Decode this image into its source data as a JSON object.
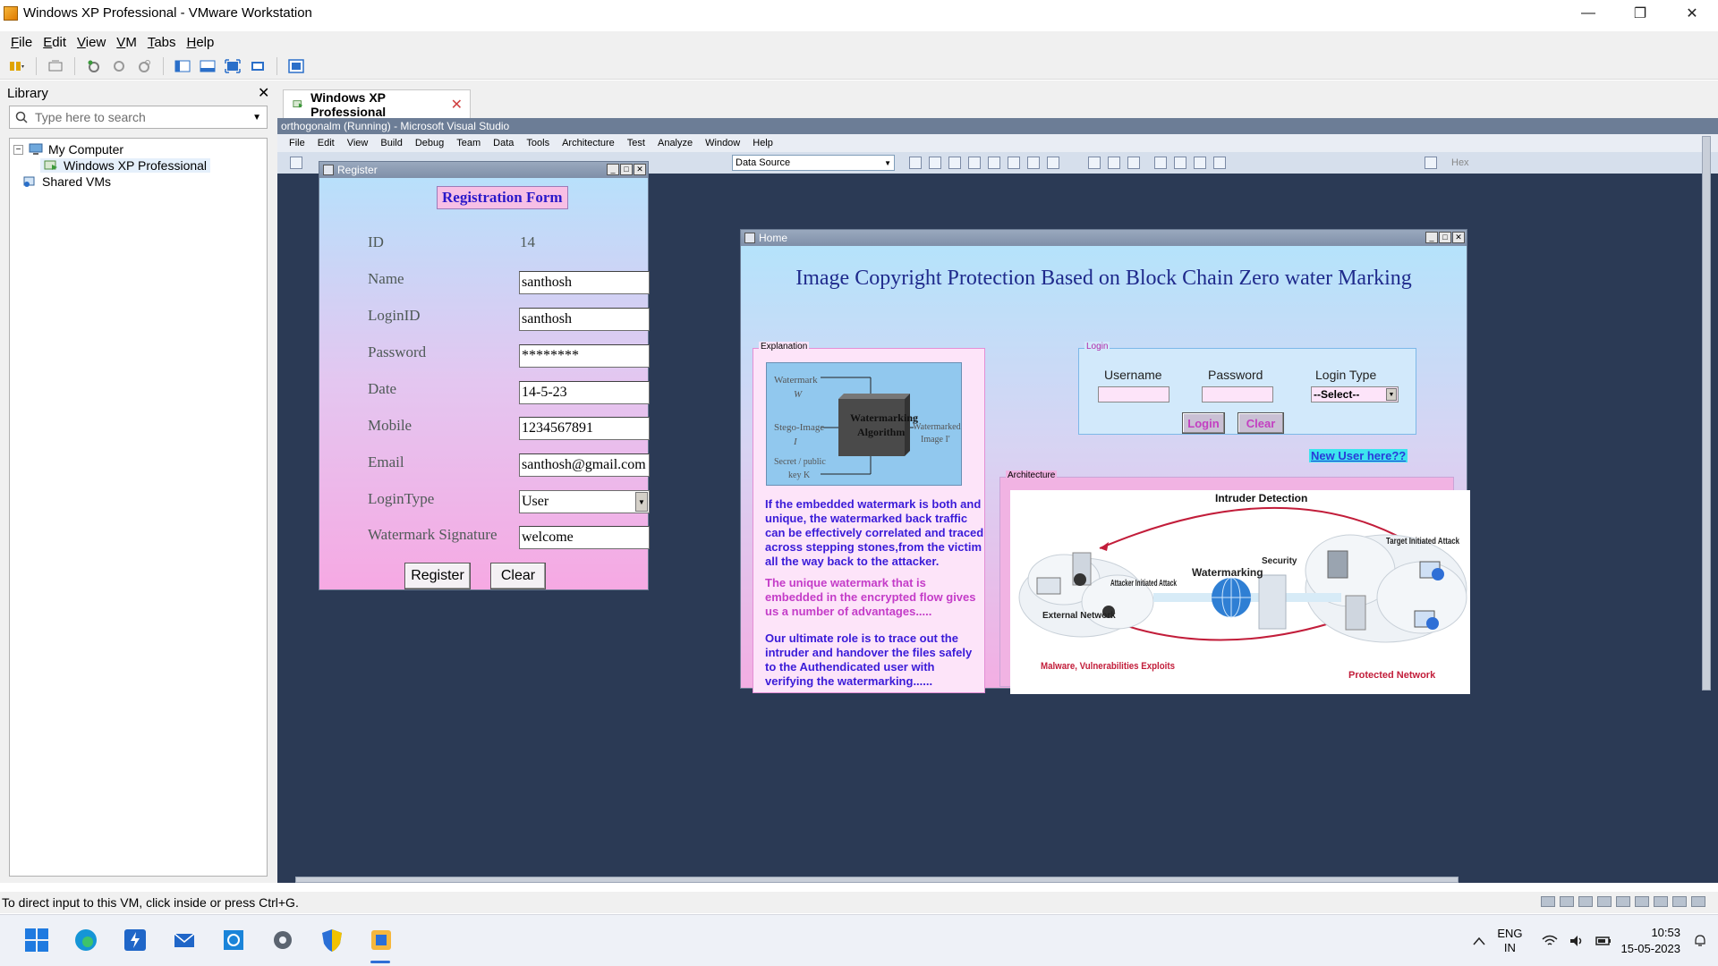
{
  "window": {
    "title": "Windows XP Professional - VMware Workstation",
    "minimize": "—",
    "restore": "❐",
    "close": "✕"
  },
  "menu": [
    "File",
    "Edit",
    "View",
    "VM",
    "Tabs",
    "Help"
  ],
  "library": {
    "title": "Library",
    "close": "✕",
    "search_placeholder": "Type here to search",
    "tree": {
      "my_computer": "My Computer",
      "vm": "Windows XP Professional",
      "shared": "Shared VMs"
    }
  },
  "tab": {
    "label": "Windows XP Professional",
    "close": "✕"
  },
  "vs": {
    "title": "orthogonalm (Running) - Microsoft Visual Studio",
    "menu": [
      "File",
      "Edit",
      "View",
      "Build",
      "Debug",
      "Team",
      "Data",
      "Tools",
      "Architecture",
      "Test",
      "Analyze",
      "Window",
      "Help"
    ],
    "datasource": "Data Source",
    "hex": "Hex"
  },
  "register": {
    "window_title": "Register",
    "form_title": "Registration Form",
    "labels": {
      "id": "ID",
      "name": "Name",
      "login_id": "LoginID",
      "password": "Password",
      "date": "Date",
      "mobile": "Mobile",
      "email": "Email",
      "login_type": "LoginType",
      "signature": "Watermark Signature"
    },
    "values": {
      "id": "14",
      "name": "santhosh",
      "login_id": "santhosh",
      "password": "********",
      "date": "14-5-23",
      "mobile": "1234567891",
      "email": "santhosh@gmail.com",
      "login_type": "User",
      "signature": "welcome"
    },
    "buttons": {
      "register": "Register",
      "clear": "Clear"
    }
  },
  "home": {
    "window_title": "Home",
    "main_title": "Image Copyright  Protection Based on Block Chain  Zero water Marking",
    "explanation": {
      "label": "Explanation",
      "figure": {
        "watermark": "Watermark",
        "w": "W",
        "stego": "Stego-Image",
        "i": "I",
        "key": "Secret / public",
        "k": "key K",
        "algo1": "Watermarking",
        "algo2": "Algorithm",
        "out1": "Watermarked",
        "out2": "Image I'"
      },
      "p1": "If the embedded watermark is both and unique, the watermarked back traffic can be effectively correlated and traced across stepping stones,from the victim all the way back to the attacker.",
      "p2": "The unique watermark that is embedded in the encrypted flow gives us a number of advantages.....",
      "p3": "Our ultimate role is to trace out the intruder and  handover the files safely to the Authendicated user with verifying the watermarking......"
    },
    "login": {
      "label": "Login",
      "username": "Username",
      "password": "Password",
      "login_type": "Login Type",
      "select": "--Select--",
      "login_btn": "Login",
      "clear_btn": "Clear"
    },
    "new_user": "New User here??",
    "architecture": {
      "label": "Architecture",
      "title": "Intruder Detection",
      "attacker": "Attacker Initiated Attack",
      "external": "External Network",
      "watermarking": "Watermarking",
      "security": "Security",
      "target": "Target Initiated Attack",
      "malware": "Malware, Vulnerabilities Exploits",
      "protected": "Protected Network"
    }
  },
  "hint": "To direct input to this VM, click inside or press Ctrl+G.",
  "tray": {
    "lang1": "ENG",
    "lang2": "IN",
    "time": "10:53",
    "date": "15-05-2023"
  },
  "colors": {
    "accent": "#2f6fd6",
    "vm_bg": "#2b3a55",
    "form_title": "#2a18c9"
  }
}
